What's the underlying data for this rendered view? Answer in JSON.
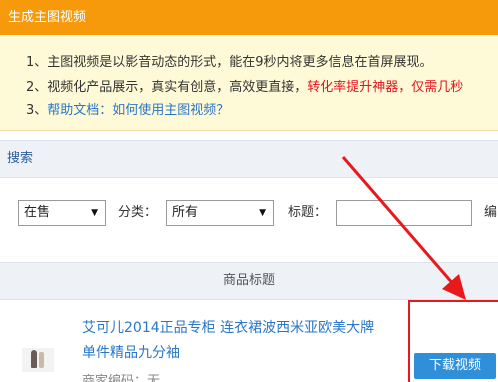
{
  "notice": {
    "title": "生成主图视频",
    "line1": "1、主图视频是以影音动态的形式，能在9秒内将更多信息在首屏展现。",
    "line2_prefix": "2、视频化产品展示，真实有创意，高效更直接，",
    "line2_highlight": "转化率提升神器，仅需几秒",
    "line3_prefix": "3、",
    "line3_link": "帮助文档：如何使用主图视频？"
  },
  "search": {
    "header": "搜索",
    "status_value": "在售",
    "category_label": "分类：",
    "category_value": "所有",
    "title_label": "标题：",
    "title_value": "",
    "code_label_partial": "编"
  },
  "table": {
    "column_product_title": "商品标题",
    "rows": [
      {
        "title": "艾可儿2014正品专柜 连衣裙波西米亚欧美大牌 单件精品九分袖",
        "code": "商家编码：无",
        "action": "下载视频"
      }
    ]
  },
  "colors": {
    "notice_header": "#f69a0b",
    "notice_body": "#fef9d6",
    "highlight_red": "#e0141e",
    "link_blue": "#2a76c7",
    "download_button": "#2f8fd8",
    "annotation_red": "#e8191c"
  }
}
